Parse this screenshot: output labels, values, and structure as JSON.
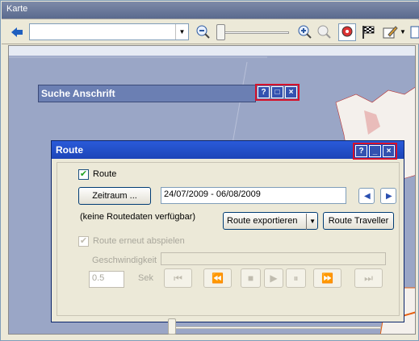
{
  "window": {
    "title": "Karte"
  },
  "toolbar": {
    "back_icon": "arrow-left-icon",
    "combo_value": "",
    "zoom_out_icon": "zoom-out-icon",
    "zoom_in_icon": "zoom-in-icon",
    "tools": [
      "map-cursor-icon",
      "checkered-flag-icon",
      "edit-icon",
      "overflow-icon"
    ]
  },
  "search_window": {
    "title": "Suche Anschrift",
    "controls": [
      "?",
      "□",
      "×"
    ]
  },
  "route_window": {
    "title": "Route",
    "controls": [
      "?",
      "_",
      "×"
    ],
    "route_checkbox_label": "Route",
    "route_checked": true,
    "period_button": "Zeitraum ...",
    "date_range": "24/07/2009 - 06/08/2009",
    "no_data_text": "(keine Routedaten verfügbar)",
    "export_button": "Route exportieren",
    "traveller_button": "Route Traveller",
    "replay_label": "Route erneut abspielen",
    "replay_checked": true,
    "speed_label": "Geschwindigkeit",
    "seconds_value": "0.5",
    "seconds_unit": "Sek",
    "player_buttons": [
      "⏮",
      "⏪",
      "■",
      "▶",
      "⏸",
      "⏩",
      "⏭"
    ]
  },
  "colors": {
    "window_blue": "#1c44b8",
    "highlight_red": "#d6112a",
    "map_water": "#9aa6c6"
  }
}
